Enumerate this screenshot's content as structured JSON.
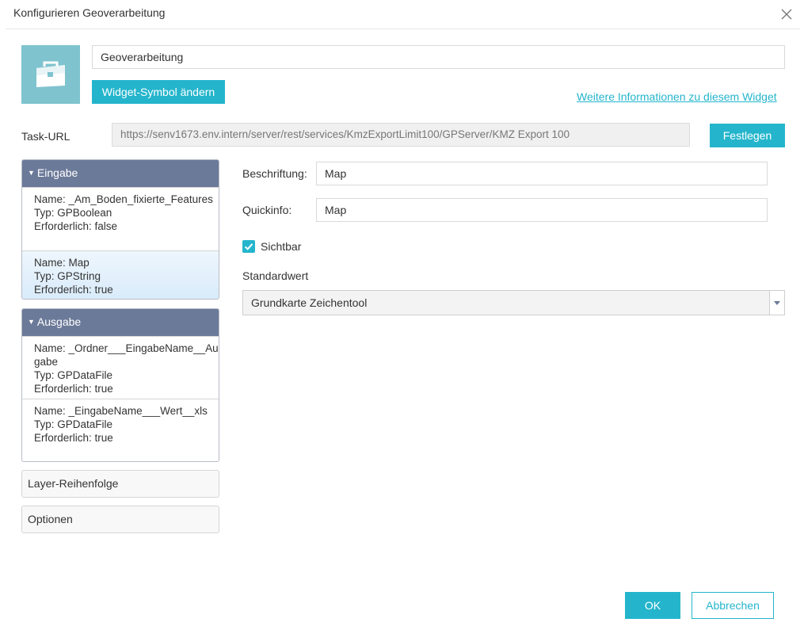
{
  "dialog": {
    "title": "Konfigurieren Geoverarbeitung",
    "close_icon": "close-icon"
  },
  "widget": {
    "name": "Geoverarbeitung",
    "icon": "toolbox-icon",
    "icon_bg": "#7fc3cf",
    "change_icon_label": "Widget-Symbol ändern",
    "more_info_link": "Weitere Informationen zu diesem Widget"
  },
  "task": {
    "label": "Task-URL",
    "url": "https://senv1673.env.intern/server/rest/services/KmzExportLimit100/GPServer/KMZ Export 100",
    "set_label": "Festlegen"
  },
  "sidebar": {
    "input": {
      "title": "Eingabe",
      "params": [
        {
          "name": "Name: _Am_Boden_fixierte_Features",
          "type": "Typ: GPBoolean",
          "required": "Erforderlich: false"
        },
        {
          "name": "Name: Map",
          "type": "Typ: GPString",
          "required": "Erforderlich: true"
        }
      ]
    },
    "output": {
      "title": "Ausgabe",
      "params": [
        {
          "name": "Name: _Ordner___EingabeName__Ausgabe",
          "type": "Typ: GPDataFile",
          "required": "Erforderlich: true"
        },
        {
          "name": "Name: _EingabeName___Wert__xls",
          "type": "Typ: GPDataFile",
          "required": "Erforderlich: true"
        }
      ]
    },
    "layer_order": "Layer-Reihenfolge",
    "options": "Optionen"
  },
  "form": {
    "label_caption": "Beschriftung:",
    "label_value": "Map",
    "tooltip_caption": "Quickinfo:",
    "tooltip_value": "Map",
    "visible_label": "Sichtbar",
    "visible_checked": true,
    "default_caption": "Standardwert",
    "default_value": "Grundkarte Zeichentool"
  },
  "footer": {
    "ok_label": "OK",
    "cancel_label": "Abbrechen"
  },
  "colors": {
    "accent": "#24b5cc",
    "panel_header": "#6c7a99"
  }
}
